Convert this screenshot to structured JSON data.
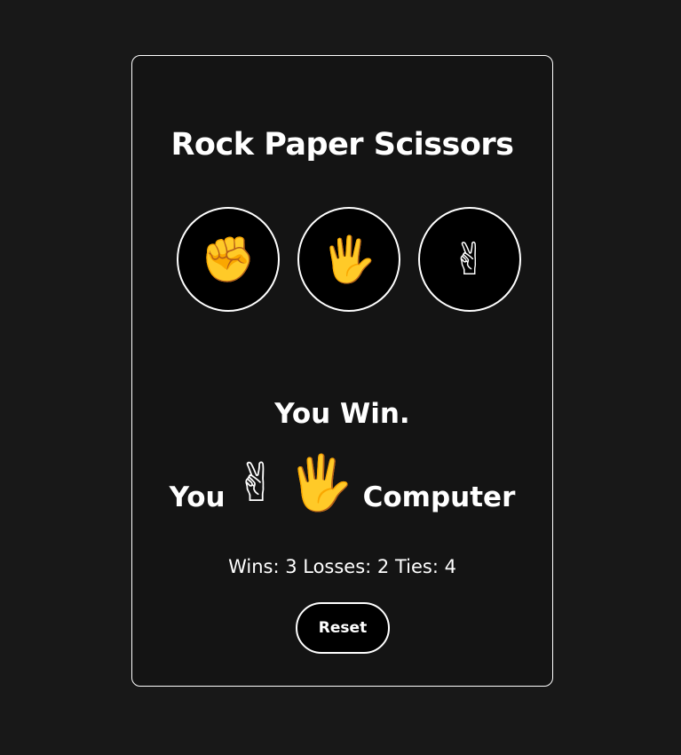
{
  "game": {
    "title": "Rock Paper Scissors",
    "choices": [
      {
        "id": "rock",
        "icon": "✊"
      },
      {
        "id": "paper",
        "icon": "🖐"
      },
      {
        "id": "scissors",
        "icon": "✌"
      }
    ],
    "result": "You Win.",
    "matchup": {
      "player_label": "You",
      "player_icon": "✌",
      "computer_icon": "🖐",
      "computer_label": "Computer"
    },
    "scores": {
      "text": "Wins: 3 Losses: 2 Ties: 4",
      "wins": 3,
      "losses": 2,
      "ties": 4
    },
    "reset_label": "Reset"
  },
  "colors": {
    "page_bg": "#181818",
    "card_bg": "#141414",
    "button_bg": "#000000",
    "border": "#ffffff",
    "emoji": "#f9c12e"
  }
}
